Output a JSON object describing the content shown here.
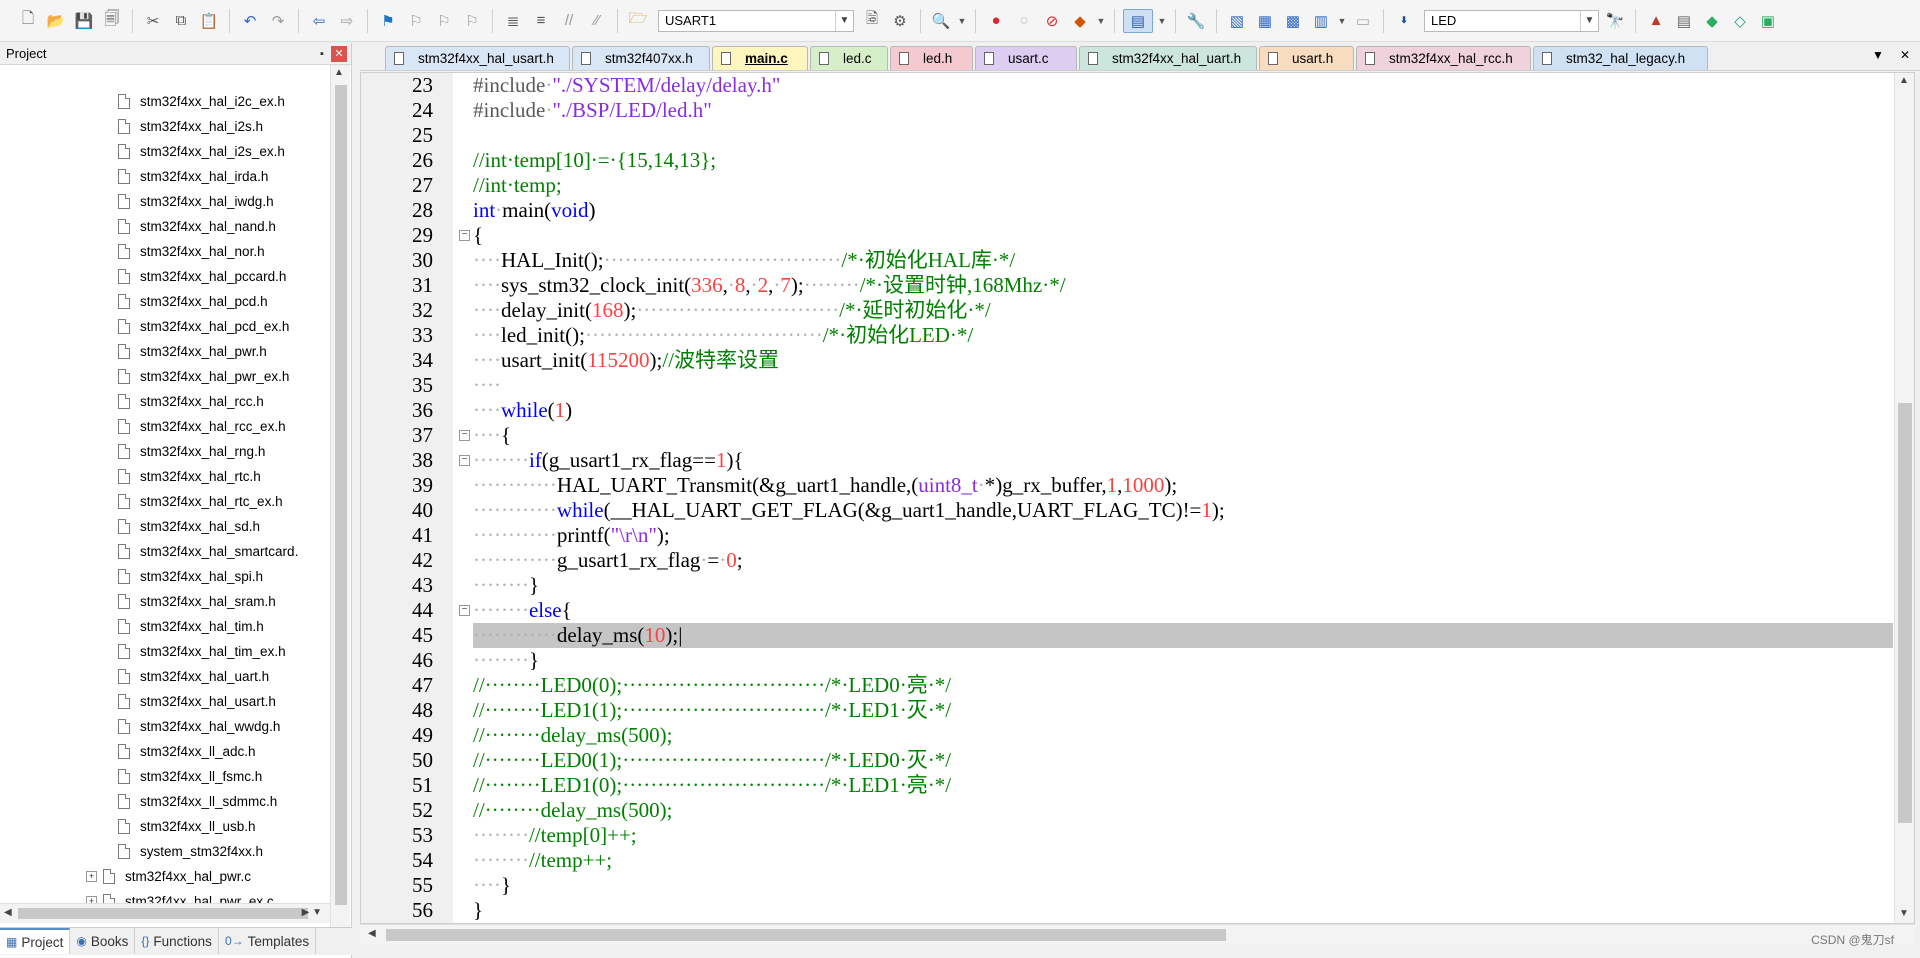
{
  "toolbar": {
    "target_value": "USART1",
    "find_value": "LED",
    "icons": [
      "new-file-icon",
      "open-folder-icon",
      "save-icon",
      "save-all-icon",
      "cut-icon",
      "copy-icon",
      "paste-icon",
      "undo-icon",
      "redo-icon",
      "nav-back-icon",
      "nav-forward-icon",
      "bookmark-icon",
      "bookmark-prev-icon",
      "bookmark-next-icon",
      "bookmark-clear-icon",
      "indent-icon",
      "unindent-icon",
      "comment-icon",
      "uncomment-icon",
      "find-in-files-icon"
    ]
  },
  "panel": {
    "title": "Project",
    "pin_glyph": "📌",
    "close_glyph": "✕",
    "tree_files": [
      "stm32f4xx_hal_i2c_ex.h",
      "stm32f4xx_hal_i2s.h",
      "stm32f4xx_hal_i2s_ex.h",
      "stm32f4xx_hal_irda.h",
      "stm32f4xx_hal_iwdg.h",
      "stm32f4xx_hal_nand.h",
      "stm32f4xx_hal_nor.h",
      "stm32f4xx_hal_pccard.h",
      "stm32f4xx_hal_pcd.h",
      "stm32f4xx_hal_pcd_ex.h",
      "stm32f4xx_hal_pwr.h",
      "stm32f4xx_hal_pwr_ex.h",
      "stm32f4xx_hal_rcc.h",
      "stm32f4xx_hal_rcc_ex.h",
      "stm32f4xx_hal_rng.h",
      "stm32f4xx_hal_rtc.h",
      "stm32f4xx_hal_rtc_ex.h",
      "stm32f4xx_hal_sd.h",
      "stm32f4xx_hal_smartcard.",
      "stm32f4xx_hal_spi.h",
      "stm32f4xx_hal_sram.h",
      "stm32f4xx_hal_tim.h",
      "stm32f4xx_hal_tim_ex.h",
      "stm32f4xx_hal_uart.h",
      "stm32f4xx_hal_usart.h",
      "stm32f4xx_hal_wwdg.h",
      "stm32f4xx_ll_adc.h",
      "stm32f4xx_ll_fsmc.h",
      "stm32f4xx_ll_sdmmc.h",
      "stm32f4xx_ll_usb.h",
      "system_stm32f4xx.h"
    ],
    "tree_sources": [
      "stm32f4xx_hal_pwr.c",
      "stm32f4xx_hal_pwr_ex.c"
    ],
    "tabs": [
      {
        "label": "Project",
        "icon": "▦"
      },
      {
        "label": "Books",
        "icon": "◉"
      },
      {
        "label": "Functions",
        "icon": "{}"
      },
      {
        "label": "Templates",
        "icon": "0→"
      }
    ]
  },
  "editor_tabs": [
    {
      "label": "stm32f4xx_hal_usart.h",
      "color": "#d9e6f5"
    },
    {
      "label": "stm32f407xx.h",
      "color": "#d9e6f5"
    },
    {
      "label": "main.c",
      "color": "#fff6bf",
      "active": true
    },
    {
      "label": "led.c",
      "color": "#d6efc8"
    },
    {
      "label": "led.h",
      "color": "#f4c9cf"
    },
    {
      "label": "usart.c",
      "color": "#dccdf1"
    },
    {
      "label": "stm32f4xx_hal_uart.h",
      "color": "#cde6dd"
    },
    {
      "label": "usart.h",
      "color": "#f8dcc0"
    },
    {
      "label": "stm32f4xx_hal_rcc.h",
      "color": "#f0d2dd"
    },
    {
      "label": "stm32_hal_legacy.h",
      "color": "#cfe1f3"
    }
  ],
  "tab_controls": {
    "dropdown": "▼",
    "close": "✕"
  },
  "code": {
    "line_numbers": [
      "23",
      "24",
      "25",
      "26",
      "27",
      "28",
      "29",
      "30",
      "31",
      "32",
      "33",
      "34",
      "35",
      "36",
      "37",
      "38",
      "39",
      "40",
      "41",
      "42",
      "43",
      "44",
      "45",
      "46",
      "47",
      "48",
      "49",
      "50",
      "51",
      "52",
      "53",
      "54",
      "55",
      "56"
    ],
    "fold_markers": [
      "−",
      "−",
      "−",
      "−"
    ],
    "current_line": "45"
  },
  "watermark": "CSDN @鬼刀sf"
}
